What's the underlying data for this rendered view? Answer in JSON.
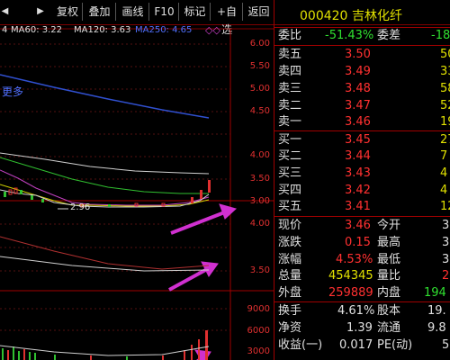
{
  "toolbar": {
    "items": [
      "更多",
      "复权",
      "叠加",
      "画线",
      "F10",
      "标记",
      "+自选",
      "返回"
    ],
    "left_arrow": "◀",
    "right_arrow": "▶"
  },
  "indicators": {
    "first": "4",
    "ma60": "MA60: 3.22",
    "ma120": "MA120: 3.63",
    "ma250": "MA250: 4.65"
  },
  "chart": {
    "price_ticks": [
      "6.00",
      "5.50",
      "5.00",
      "4.50",
      "4.00",
      "3.50",
      "3.00"
    ],
    "low_label": "2.96",
    "mid_ticks": [
      "4.00",
      "3.50"
    ],
    "vol_ticks": [
      "9000",
      "6000",
      "3000"
    ],
    "colors": {
      "ma_white": "#d0d0d0",
      "ma_yellow": "#d0d000",
      "ma_purple": "#c040c0",
      "ma_green": "#30c030",
      "ma_blue": "#3050d0",
      "arrow": "#d030d0"
    }
  },
  "panel": {
    "code": "000420",
    "name": "吉林化纤",
    "weibi": {
      "label": "委比",
      "value": "-51.43%",
      "label2": "委差",
      "value2": "-18"
    },
    "sells": [
      {
        "label": "卖五",
        "price": "3.50",
        "vol": "50"
      },
      {
        "label": "卖四",
        "price": "3.49",
        "vol": "33"
      },
      {
        "label": "卖三",
        "price": "3.48",
        "vol": "58"
      },
      {
        "label": "卖二",
        "price": "3.47",
        "vol": "52"
      },
      {
        "label": "卖一",
        "price": "3.46",
        "vol": "19"
      }
    ],
    "buys": [
      {
        "label": "买一",
        "price": "3.45",
        "vol": "27"
      },
      {
        "label": "买二",
        "price": "3.44",
        "vol": "7"
      },
      {
        "label": "买三",
        "price": "3.43",
        "vol": "4"
      },
      {
        "label": "买四",
        "price": "3.42",
        "vol": "4"
      },
      {
        "label": "买五",
        "price": "3.41",
        "vol": "12"
      }
    ],
    "quote": [
      {
        "l1": "现价",
        "v1": "3.46",
        "l2": "今开",
        "v2": "3"
      },
      {
        "l1": "涨跌",
        "v1": "0.15",
        "l2": "最高",
        "v2": "3"
      },
      {
        "l1": "涨幅",
        "v1": "4.53%",
        "l2": "最低",
        "v2": "3"
      },
      {
        "l1": "总量",
        "v1": "454345",
        "l2": "量比",
        "v2": "2"
      },
      {
        "l1": "外盘",
        "v1": "259889",
        "l2": "内盘",
        "v2": "194"
      }
    ],
    "stats": [
      {
        "l1": "换手",
        "v1": "4.61%",
        "l2": "股本",
        "v2": "19."
      },
      {
        "l1": "净资",
        "v1": "1.39",
        "l2": "流通",
        "v2": "9.8"
      },
      {
        "l1": "收益(一)",
        "v1": "0.017",
        "l2": "PE(动)",
        "v2": "5"
      }
    ]
  }
}
